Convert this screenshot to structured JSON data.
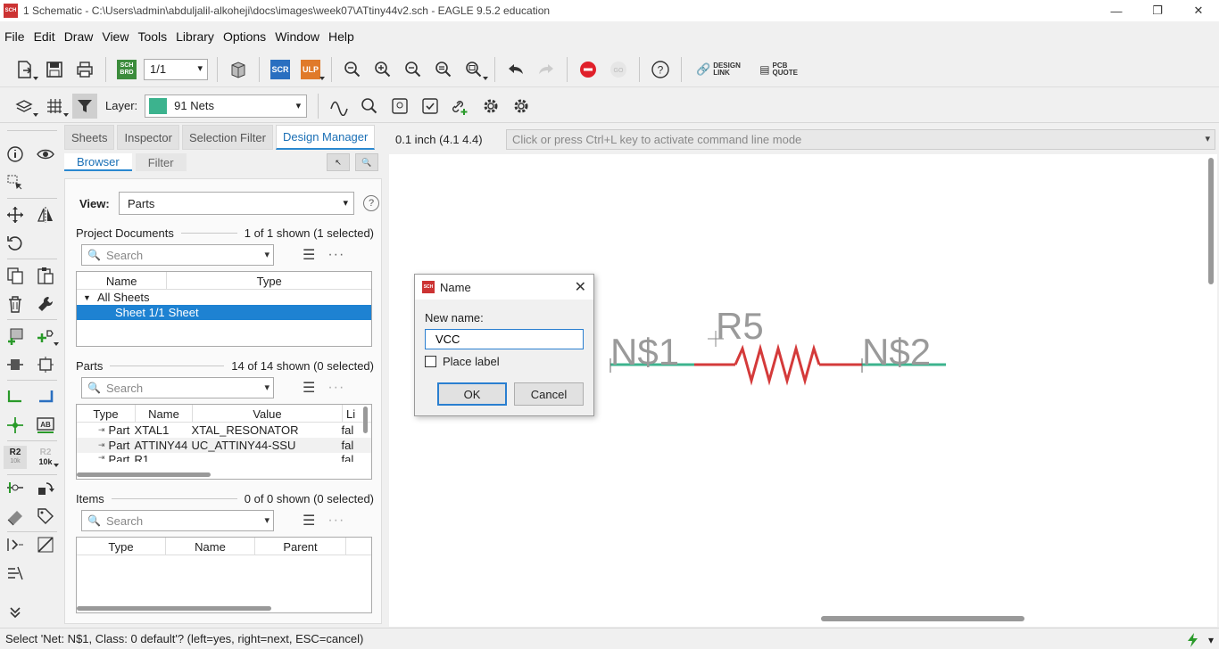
{
  "window": {
    "title": "1 Schematic - C:\\Users\\admin\\abduljalil-alkoheji\\docs\\images\\week07\\ATtiny44v2.sch - EAGLE 9.5.2 education",
    "app_icon": "SCH"
  },
  "menu": [
    "File",
    "Edit",
    "Draw",
    "View",
    "Tools",
    "Library",
    "Options",
    "Window",
    "Help"
  ],
  "toolbar": {
    "sheet_value": "1/1",
    "sch_brd": "SCH BRD",
    "scr": "SCR",
    "ulp": "ULP",
    "design_link": "DESIGN LINK",
    "pcb_quote": "PCB QUOTE",
    "colors": {
      "stop": "#e0202a",
      "scr": "#2a6fc0",
      "ulp": "#e07a2a",
      "sch": "#3c8c3c"
    }
  },
  "layer": {
    "label": "Layer:",
    "value": "91 Nets",
    "swatch": "#3cb38e"
  },
  "lefttools": {
    "r2": "R2",
    "r2_sub": "10k",
    "ab": "AB"
  },
  "panel": {
    "tabs": [
      "Sheets",
      "Inspector",
      "Selection Filter",
      "Design Manager"
    ],
    "subtabs": [
      "Browser",
      "Filter"
    ],
    "view_label": "View:",
    "view_value": "Parts",
    "help": "?",
    "project_docs": {
      "title": "Project Documents",
      "count": "1 of 1 shown (1 selected)",
      "search_placeholder": "Search",
      "columns": [
        "Name",
        "Type"
      ],
      "group": "All Sheets",
      "rows": [
        {
          "name": "Sheet 1/1",
          "type": "Sheet"
        }
      ]
    },
    "parts": {
      "title": "Parts",
      "count": "14 of 14 shown (0 selected)",
      "search_placeholder": "Search",
      "columns": [
        "Type",
        "Name",
        "Value",
        "Li"
      ],
      "rows": [
        {
          "type": "Part",
          "name": "XTAL1",
          "value": "XTAL_RESONATOR",
          "li": "fal"
        },
        {
          "type": "Part",
          "name": "ATTINY44",
          "value": "UC_ATTINY44-SSU",
          "li": "fal"
        },
        {
          "type": "Part",
          "name": "R1",
          "value": "",
          "li": "fal"
        }
      ]
    },
    "items": {
      "title": "Items",
      "count": "0 of 0 shown (0 selected)",
      "search_placeholder": "Search",
      "columns": [
        "Type",
        "Name",
        "Parent"
      ]
    }
  },
  "canvas": {
    "coord": "0.1 inch (4.1 4.4)",
    "cmd_placeholder": "Click or press Ctrl+L key to activate command line mode",
    "labels": {
      "net1": "N$1",
      "part": "R5",
      "net2": "N$2"
    },
    "colors": {
      "net": "#3cb38e",
      "wire": "#d43a3a",
      "label": "#9a9a9a"
    }
  },
  "dialog": {
    "title": "Name",
    "new_name_label": "New name:",
    "new_name_value": "VCC",
    "place_label": "Place label",
    "ok": "OK",
    "cancel": "Cancel"
  },
  "status": {
    "text": "Select 'Net: N$1, Class: 0 default'? (left=yes, right=next, ESC=cancel)"
  }
}
